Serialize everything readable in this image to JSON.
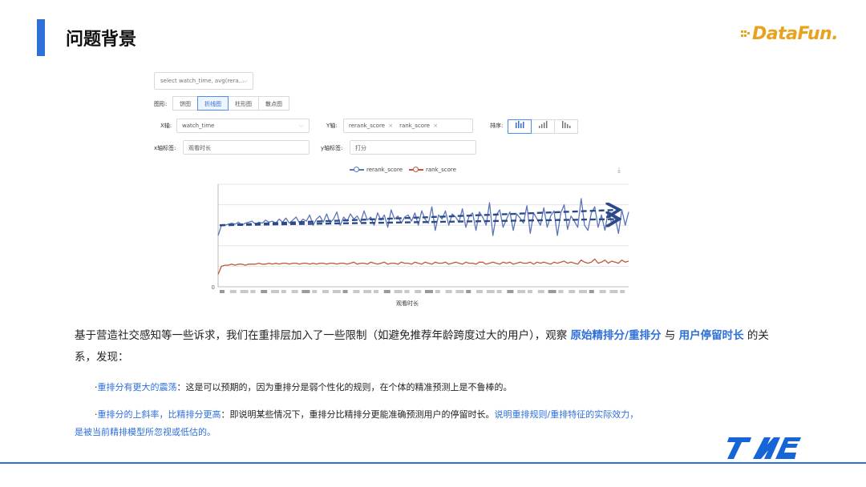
{
  "slide": {
    "title": "问题背景"
  },
  "logo": {
    "text": "DataFun."
  },
  "query": {
    "select_text": "select watch_time, avg(rera..."
  },
  "chart_type": {
    "label": "图形:",
    "options": [
      "饼图",
      "折线图",
      "柱形图",
      "散点图"
    ],
    "selected": "折线图"
  },
  "x_axis": {
    "label": "X轴:",
    "value": "watch_time"
  },
  "y_axis": {
    "label": "Y轴:",
    "tags": [
      "rerank_score",
      "rank_score"
    ]
  },
  "sort": {
    "label": "排序:",
    "options": [
      "bar-sort-icon",
      "bar-sort-asc-icon",
      "bar-sort-desc-icon"
    ],
    "selected_index": 0
  },
  "x_label_field": {
    "label": "x轴标签:",
    "value": "观看时长"
  },
  "y_label_field": {
    "label": "y轴标签:",
    "value": "打分"
  },
  "chart_data": {
    "type": "line",
    "xlabel": "观看时长",
    "ylabel": "",
    "y_tick_labels": [
      "0"
    ],
    "legend": [
      "rerank_score",
      "rank_score"
    ],
    "legend_position": "top",
    "colors": {
      "rerank_score": "#5b75b8",
      "rank_score": "#c0563f",
      "trend_arrow": "#2c4a8a"
    },
    "series": [
      {
        "name": "rerank_score",
        "values": [
          0.5,
          0.6,
          0.6,
          0.61,
          0.62,
          0.61,
          0.63,
          0.6,
          0.62,
          0.63,
          0.64,
          0.61,
          0.63,
          0.62,
          0.65,
          0.63,
          0.64,
          0.62,
          0.66,
          0.63,
          0.67,
          0.62,
          0.65,
          0.68,
          0.62,
          0.66,
          0.64,
          0.7,
          0.6,
          0.66,
          0.69,
          0.63,
          0.71,
          0.62,
          0.66,
          0.73,
          0.6,
          0.68,
          0.64,
          0.71,
          0.66,
          0.69,
          0.63,
          0.74,
          0.65,
          0.68,
          0.6,
          0.72,
          0.65,
          0.7,
          0.58,
          0.75,
          0.66,
          0.69,
          0.62,
          0.68,
          0.7,
          0.64,
          0.72,
          0.6,
          0.74,
          0.66,
          0.62,
          0.78,
          0.55,
          0.7,
          0.66,
          0.74,
          0.6,
          0.71,
          0.68,
          0.63,
          0.76,
          0.58,
          0.69,
          0.72,
          0.55,
          0.73,
          0.68,
          0.6,
          0.82,
          0.5,
          0.7,
          0.75,
          0.58,
          0.66,
          0.73,
          0.55,
          0.71,
          0.67,
          0.62,
          0.79,
          0.52,
          0.72,
          0.66,
          0.6,
          0.77,
          0.58,
          0.69,
          0.74,
          0.5,
          0.72,
          0.8,
          0.56,
          0.69,
          0.64,
          0.58,
          0.86,
          0.6,
          0.55,
          0.72,
          0.78,
          0.58,
          0.7,
          0.55,
          0.74,
          0.62,
          0.68,
          0.52,
          0.75,
          0.6,
          0.73
        ]
      },
      {
        "name": "rank_score",
        "values": [
          0.12,
          0.2,
          0.21,
          0.21,
          0.22,
          0.21,
          0.22,
          0.22,
          0.21,
          0.22,
          0.22,
          0.22,
          0.23,
          0.22,
          0.22,
          0.23,
          0.22,
          0.23,
          0.22,
          0.23,
          0.23,
          0.22,
          0.23,
          0.23,
          0.22,
          0.23,
          0.23,
          0.22,
          0.23,
          0.22,
          0.23,
          0.23,
          0.22,
          0.23,
          0.23,
          0.22,
          0.23,
          0.23,
          0.22,
          0.23,
          0.24,
          0.22,
          0.23,
          0.23,
          0.22,
          0.24,
          0.23,
          0.22,
          0.23,
          0.24,
          0.22,
          0.23,
          0.23,
          0.22,
          0.24,
          0.23,
          0.23,
          0.22,
          0.24,
          0.23,
          0.22,
          0.24,
          0.23,
          0.22,
          0.24,
          0.23,
          0.23,
          0.24,
          0.22,
          0.23,
          0.24,
          0.23,
          0.22,
          0.24,
          0.23,
          0.23,
          0.22,
          0.24,
          0.24,
          0.22,
          0.23,
          0.24,
          0.23,
          0.22,
          0.24,
          0.23,
          0.24,
          0.22,
          0.23,
          0.24,
          0.23,
          0.23,
          0.24,
          0.22,
          0.24,
          0.23,
          0.24,
          0.23,
          0.22,
          0.24,
          0.23,
          0.24,
          0.25,
          0.23,
          0.24,
          0.23,
          0.22,
          0.26,
          0.24,
          0.23,
          0.24,
          0.27,
          0.23,
          0.24,
          0.26,
          0.23,
          0.25,
          0.24,
          0.23,
          0.26,
          0.24,
          0.25
        ]
      }
    ],
    "ylim": [
      0,
      1
    ]
  },
  "paragraph": {
    "p1": "基于营造社交感知等一些诉求，我们在重排层加入了一些限制（如避免推荐年龄跨度过大的用户），观察 ",
    "h1": "原始精排分/重排分",
    "p2": " 与 ",
    "h2": "用户停留时长",
    "p3": " 的关系，发现："
  },
  "bullet1": {
    "dot": "·",
    "highlight": "重排分有更大的震荡",
    "text": "：这是可以预期的，因为重排分是弱个性化的规则，在个体的精准预测上是不鲁棒的。"
  },
  "bullet2": {
    "dot": "·",
    "highlight": "重排分的上斜率，比精排分更高",
    "text": "：即说明某些情况下，重排分比精排分更能准确预测用户的停留时长。",
    "highlight2": "说明重排规则/重排特征的实际效力，"
  },
  "bullet3": {
    "highlight": "是被当前精排模型所忽视或低估的。"
  }
}
